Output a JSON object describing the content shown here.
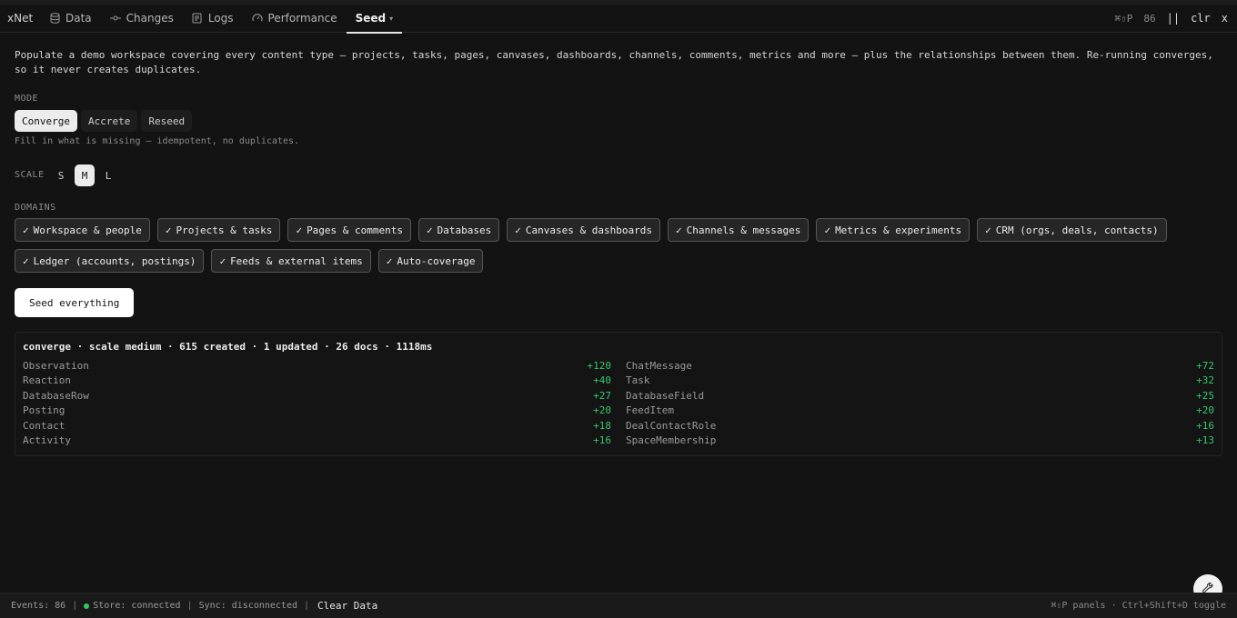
{
  "app": {
    "title": "xNet"
  },
  "tabs": [
    {
      "label": "Data",
      "icon": "database-icon"
    },
    {
      "label": "Changes",
      "icon": "commit-icon"
    },
    {
      "label": "Logs",
      "icon": "logs-icon"
    },
    {
      "label": "Performance",
      "icon": "gauge-icon"
    },
    {
      "label": "Seed",
      "icon": "chevron-down-icon",
      "active": true
    }
  ],
  "toolbar": {
    "shortcut": "⌘⇧P",
    "count": "86",
    "pause": "||",
    "clear": "clr",
    "close": "x"
  },
  "description": "Populate a demo workspace covering every content type — projects, tasks, pages, canvases, dashboards, channels, comments, metrics and more — plus the relationships between them. Re-running converges, so it never creates duplicates.",
  "mode": {
    "label": "MODE",
    "options": [
      "Converge",
      "Accrete",
      "Reseed"
    ],
    "selected": "Converge",
    "hint": "Fill in what is missing — idempotent, no duplicates."
  },
  "scale": {
    "label": "SCALE",
    "options": [
      "S",
      "M",
      "L"
    ],
    "selected": "M"
  },
  "domains": {
    "label": "DOMAINS",
    "items": [
      "Workspace & people",
      "Projects & tasks",
      "Pages & comments",
      "Databases",
      "Canvases & dashboards",
      "Channels & messages",
      "Metrics & experiments",
      "CRM (orgs, deals, contacts)",
      "Ledger (accounts, postings)",
      "Feeds & external items",
      "Auto-coverage"
    ],
    "check": "✓"
  },
  "seed_button": "Seed everything",
  "result": {
    "summary": "converge · scale medium · 615 created · 1 updated · 26 docs · 1118ms",
    "left": [
      {
        "name": "Observation",
        "count": "+120"
      },
      {
        "name": "Reaction",
        "count": "+40"
      },
      {
        "name": "DatabaseRow",
        "count": "+27"
      },
      {
        "name": "Posting",
        "count": "+20"
      },
      {
        "name": "Contact",
        "count": "+18"
      },
      {
        "name": "Activity",
        "count": "+16"
      }
    ],
    "right": [
      {
        "name": "ChatMessage",
        "count": "+72"
      },
      {
        "name": "Task",
        "count": "+32"
      },
      {
        "name": "DatabaseField",
        "count": "+25"
      },
      {
        "name": "FeedItem",
        "count": "+20"
      },
      {
        "name": "DealContactRole",
        "count": "+16"
      },
      {
        "name": "SpaceMembership",
        "count": "+13"
      }
    ]
  },
  "status": {
    "events": "Events: 86",
    "store": "Store: connected",
    "sync": "Sync: disconnected",
    "clear": "Clear Data",
    "hint": "⌘⇧P panels · Ctrl+Shift+D toggle"
  },
  "colors": {
    "accent_green": "#35c46a",
    "status_dot": "#2ecc5f",
    "background": "#131313"
  }
}
